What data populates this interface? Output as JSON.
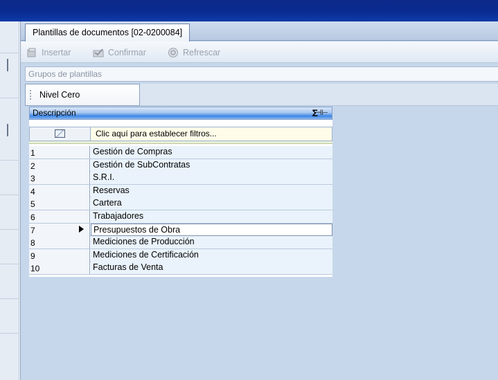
{
  "tab": {
    "label": "Plantillas de documentos [02-0200084]"
  },
  "toolbar": {
    "insert_label": "Insertar",
    "confirm_label": "Confirmar",
    "refresh_label": "Refrescar"
  },
  "group_bar": {
    "label": "Grupos de plantillas"
  },
  "level": {
    "label": "Nivel Cero"
  },
  "grid": {
    "column_header": "Descripción",
    "sigma": "Σ",
    "pin": "⊣⊢",
    "filter_text": "Clic aquí para establecer filtros...",
    "rows": [
      {
        "num": "1",
        "desc": "Gestión de Compras"
      },
      {
        "num": "2",
        "desc": "Gestión de SubContratas"
      },
      {
        "num": "3",
        "desc": "S.R.I."
      },
      {
        "num": "4",
        "desc": "Reservas"
      },
      {
        "num": "5",
        "desc": "Cartera"
      },
      {
        "num": "6",
        "desc": "Trabajadores"
      },
      {
        "num": "7",
        "desc": "Presupuestos de Obra"
      },
      {
        "num": "8",
        "desc": "Mediciones de Producción"
      },
      {
        "num": "9",
        "desc": "Mediciones de Certificación"
      },
      {
        "num": "10",
        "desc": "Facturas de Venta"
      }
    ],
    "selected_row": "7"
  },
  "icons": {
    "insert": "insert-icon",
    "confirm": "confirm-icon",
    "refresh": "refresh-icon",
    "filter": "filter-icon"
  },
  "colors": {
    "title_bar": "#0b2a8a",
    "window_bg": "#c7d7eb",
    "row_bg": "#eaf3fb",
    "filter_bg": "#fffde9"
  }
}
